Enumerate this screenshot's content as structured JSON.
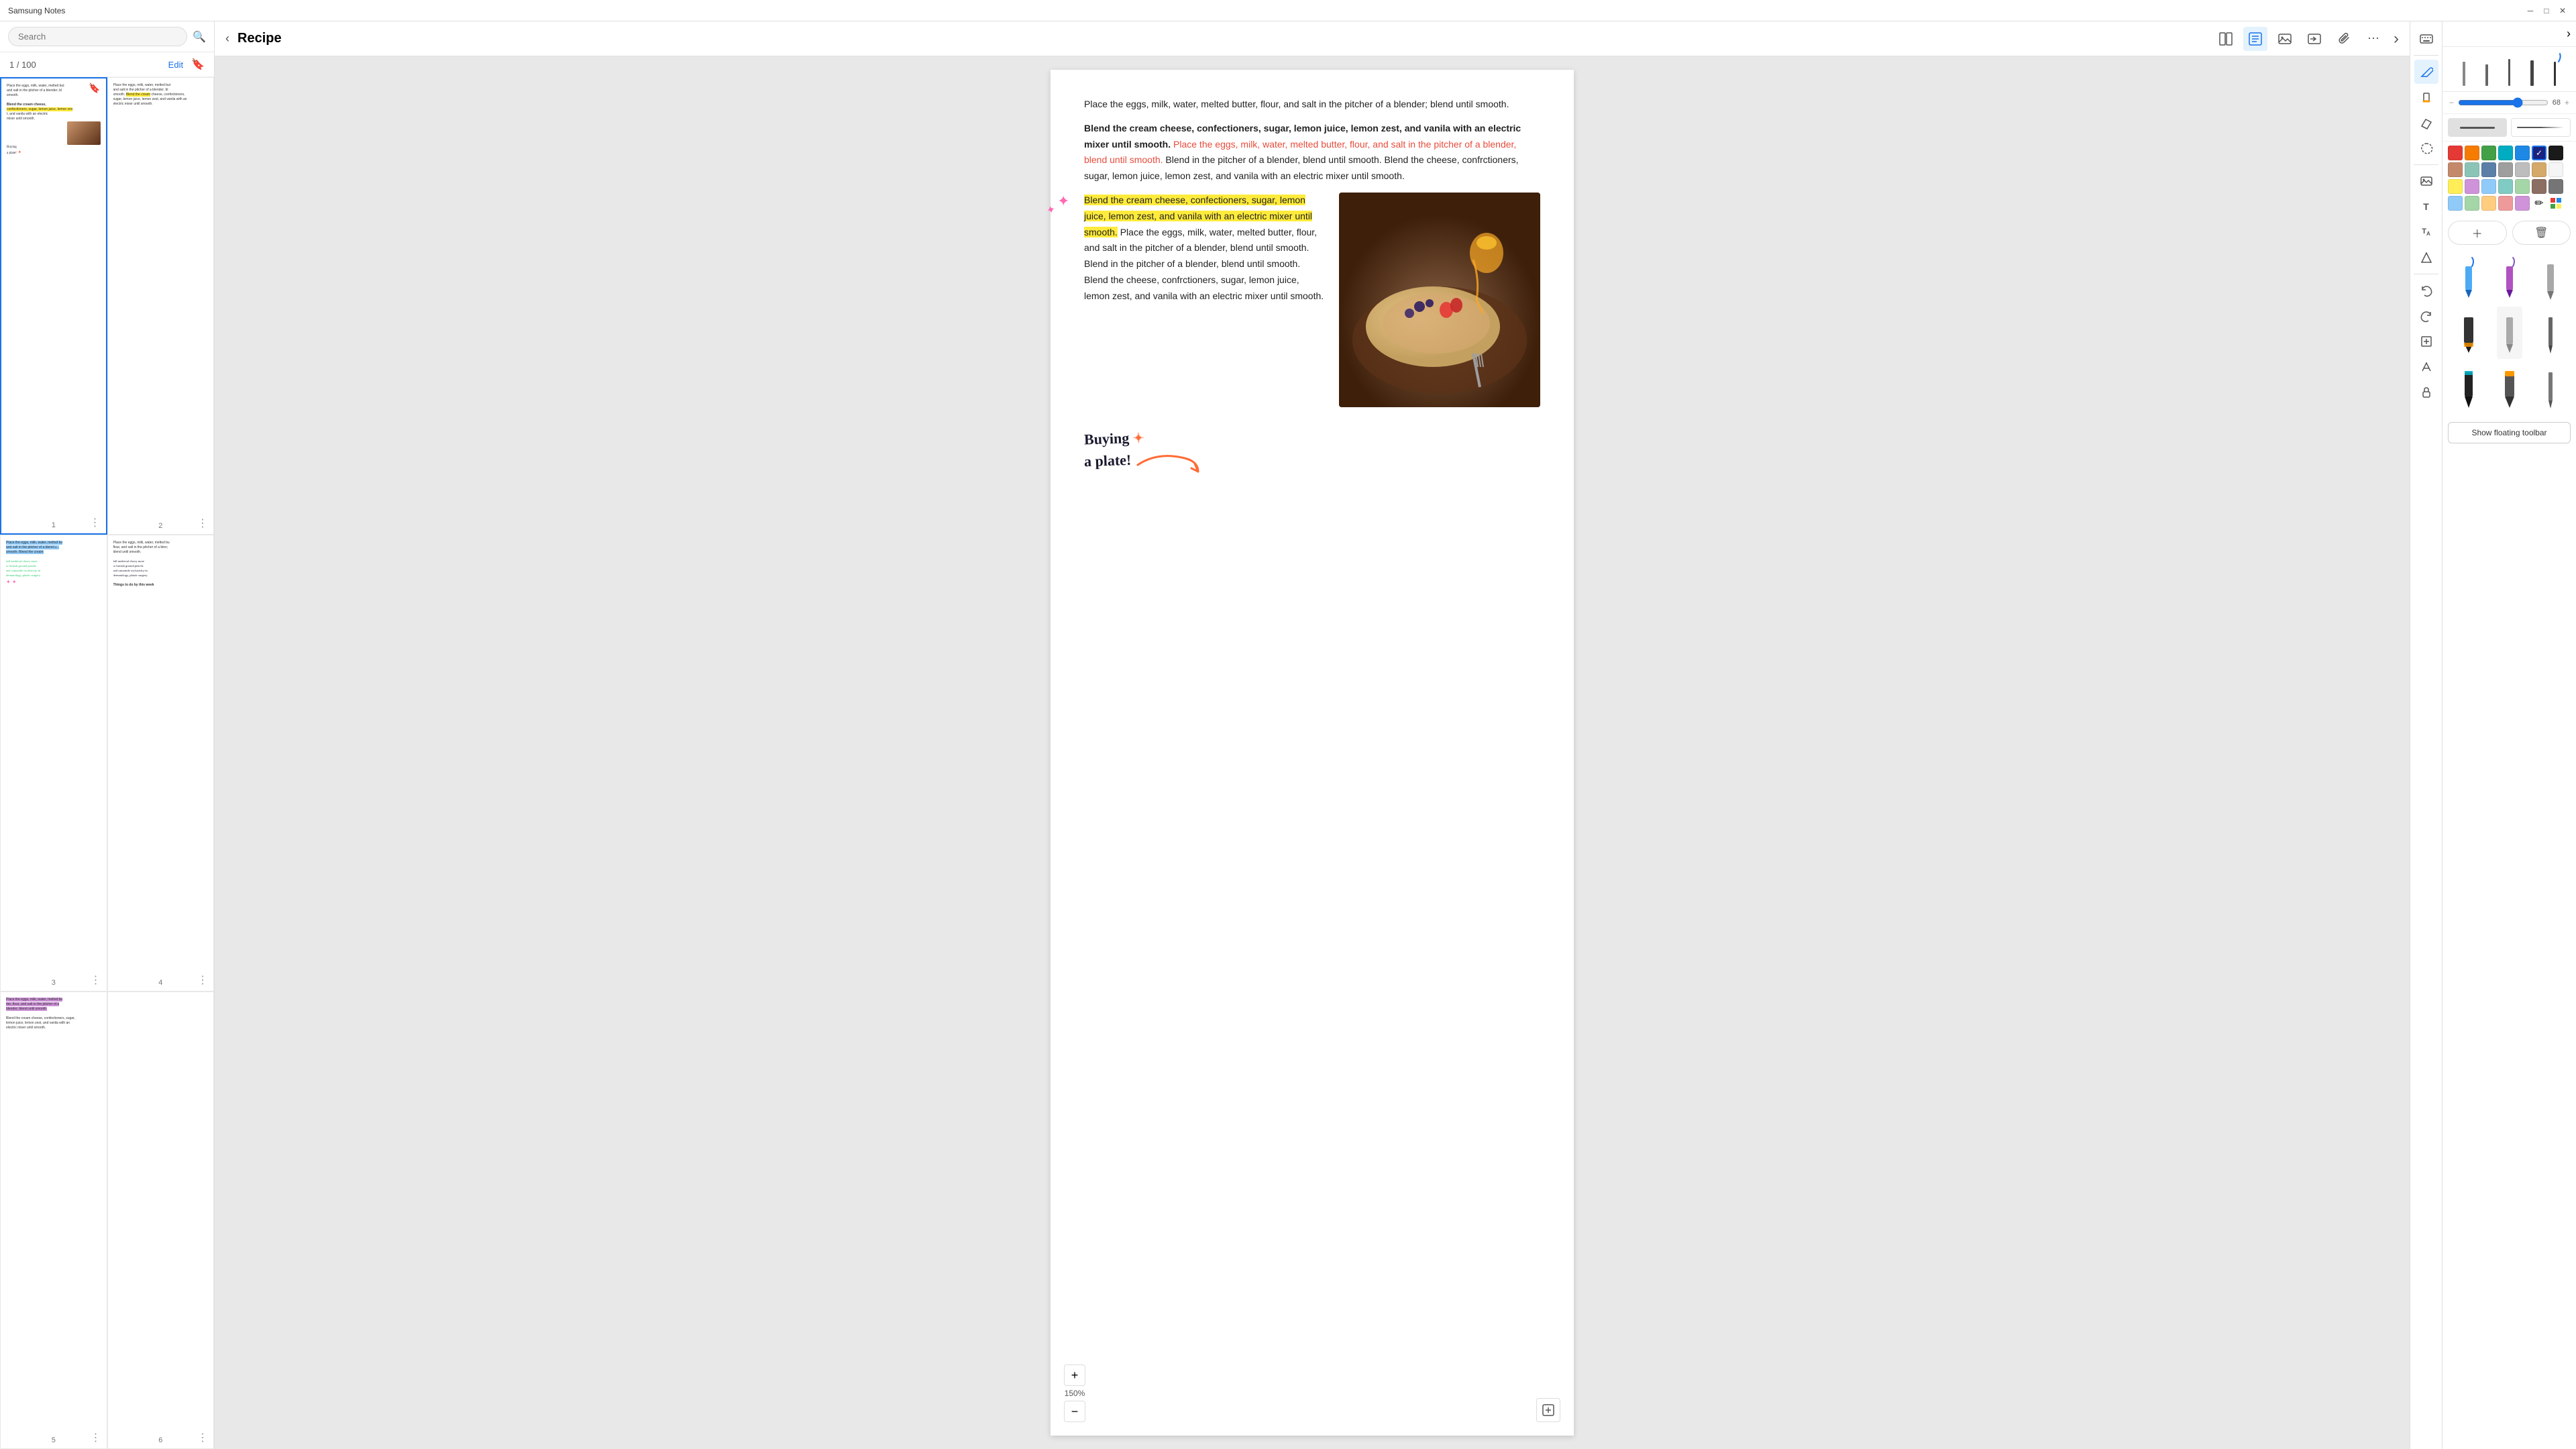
{
  "titlebar": {
    "title": "Samsung Notes",
    "minimize": "─",
    "maximize": "□",
    "close": "✕"
  },
  "sidebar": {
    "search_placeholder": "Search",
    "page_count": "1 / 100",
    "edit_label": "Edit",
    "thumbnails": [
      {
        "id": 1,
        "active": true,
        "has_bookmark": true,
        "label": "1",
        "text_preview": "Place the eggs, milk, water, melted butter, flour, and salt in the pitcher of a blender; blend until smooth. Blend the cream cheese, confectioners, sugar, lemon juice, lemon zest, and vanila with an electric mixer until smooth.",
        "has_image": true,
        "has_handwriting": true
      },
      {
        "id": 2,
        "label": "2",
        "text_preview": "Place the eggs, milk, water, melted butter, flour, and salt in the pitcher of a blender; blend until smooth. Blend the cream cheese, confectioners, sugar, lemon juice, lemon zest, and vanila with an electric mixer until smooth.",
        "highlight": true
      },
      {
        "id": 3,
        "label": "3",
        "text_preview": "Place the eggs, milk, water, melted butter, flour, and salt in the pitcher of a blender; blend until smooth. Blend the cream",
        "has_handwriting_green": true
      },
      {
        "id": 4,
        "label": "4",
        "text_preview": "Place the eggs, milk, water, melted butter, flour, and salt in the pitcher of a blen; blend until smooth.",
        "has_bold_text": true,
        "bold_text": "Things to do by this week"
      },
      {
        "id": 5,
        "label": "5",
        "text_preview": "Place the eggs, milk, water, melted butter, flour, and salt in the pitcher of a blender; blend until smooth. Blend the cream cheese...",
        "has_highlight_purple": true
      },
      {
        "id": 6,
        "label": "6",
        "text_preview": ""
      }
    ]
  },
  "main": {
    "title": "Recipe",
    "zoom": "150%",
    "paragraph1": "Place the eggs, milk, water, melted butter, flour, and salt in the pitcher of a blender; blend until smooth.",
    "paragraph2_bold": "Blend the cream cheese, confectioners, sugar, lemon juice, lemon zest, and vanila with an electric mixer until smooth.",
    "paragraph2_red": "Place the eggs, milk, water, melted butter, flour, and salt in the pitcher of a blender, blend until smooth.",
    "paragraph2_cont": "Blend in the pitcher of a blender, blend until smooth. Blend the cheese, confrctioners, sugar, lemon juice, lemon zest, and vanila with an electric mixer until smooth.",
    "paragraph3_highlight": "Blend the cream cheese, confectioners, sugar, lemon juice, lemon zest, and vanila with an electric mixer until smooth.",
    "paragraph3_cont": "Place the eggs, milk, water, melted butter, flour, and salt in the pitcher of a blender, blend until smooth. Blend in the pitcher of a blender, blend until smooth. Blend the cheese, confrctioners, sugar, lemon juice, lemon zest, and vanila with an electric mixer until smooth.",
    "handwriting_line1": "Buying",
    "handwriting_line2": "a plate!",
    "zoom_plus": "+",
    "zoom_minus": "−"
  },
  "toolbar": {
    "back_icon": "‹",
    "book_icon": "⊞",
    "doc_icon": "☰",
    "image_icon": "🖼",
    "share_icon": "⬡",
    "attach_icon": "📎",
    "more_icon": "⋯",
    "forward_icon": "›"
  },
  "right_panel": {
    "slider_value": 68,
    "colors_row1": [
      "#e53935",
      "#f57c00",
      "#43a047",
      "#00acc1",
      "#1e88e5",
      "#5e35b1",
      "#1a1a1a"
    ],
    "colors_row2": [
      "#c4896b",
      "#8bc4b7",
      "#5b7fa6",
      "#9e9e9e",
      "#bdbdbd",
      "#d4a96a",
      "#f5f5f5"
    ],
    "colors_row3": [
      "#ffee58",
      "#ce93d8",
      "#90caf9",
      "#80cbc4",
      "#a5d6a7",
      "#8d6e63",
      "#757575"
    ],
    "colors_row4": [
      "#90caf9",
      "#a5d6a7",
      "#ffcc80",
      "#ef9a9a",
      "#ce93d8",
      "#b0bec5",
      "#e0e0e0"
    ],
    "selected_color_index": 6,
    "pen_tools": [
      "blue_pen",
      "purple_pen",
      "gray_pen"
    ],
    "pen_tools2": [
      "black_wide",
      "gray_medium",
      "thin"
    ],
    "pen_tools3": [
      "black_brush",
      "orange_highlighter",
      "thin2"
    ],
    "show_floating": "Show floating toolbar"
  },
  "annotator_sidebar": {
    "keyboard_icon": "⌨",
    "pen_icon": "✏",
    "highlight_icon": "▭",
    "eraser_icon": "◻",
    "lasso_icon": "⬡",
    "image_add_icon": "🖼",
    "text_icon": "T",
    "format_icon": "Tz",
    "heart_icon": "♡",
    "lock_icon": "🔒",
    "undo_icon": "↩",
    "redo_icon": "↪",
    "move_icon": "⬕",
    "resize_icon": "↕"
  }
}
